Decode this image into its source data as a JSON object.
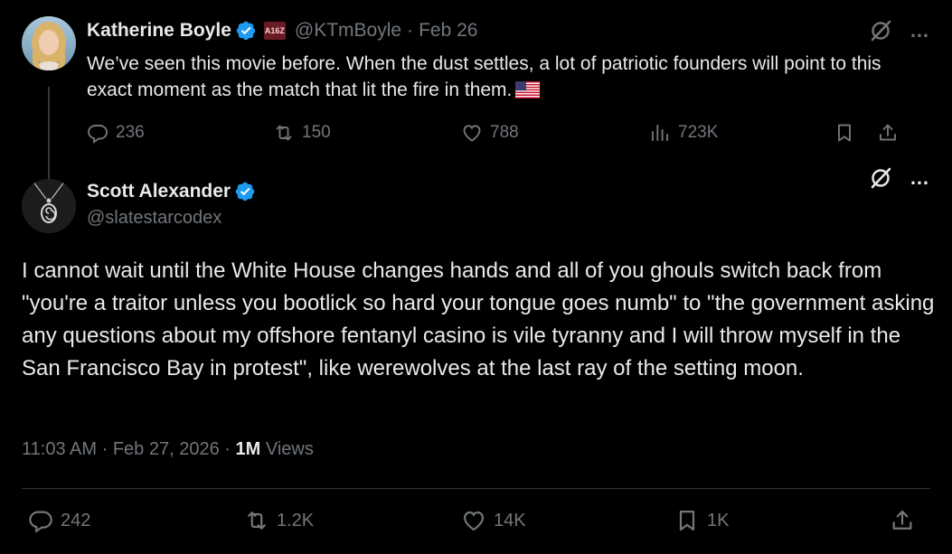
{
  "parent_tweet": {
    "author_name": "Katherine Boyle",
    "affiliate_badge": "A16Z",
    "handle": "@KTmBoyle",
    "separator": "·",
    "date": "Feb 26",
    "text": "We’ve seen this movie before. When the dust settles, a lot of patriotic founders will point to this exact moment as the match that lit the fire in them.",
    "actions": {
      "replies": "236",
      "reposts": "150",
      "likes": "788",
      "views": "723K"
    }
  },
  "main_tweet": {
    "author_name": "Scott Alexander",
    "handle": "@slatestarcodex",
    "text": "I cannot wait until the White House changes hands and all of you ghouls switch back from \"you're a traitor unless you bootlick so hard your tongue goes numb\" to \"the government asking any questions about my offshore fentanyl casino is vile tyranny and I will throw myself in the San Francisco Bay in protest\", like werewolves at the last ray of the setting moon.",
    "time": "11:03 AM",
    "separator": "·",
    "date": "Feb 27, 2026",
    "views_count": "1M",
    "views_label": "Views",
    "actions": {
      "replies": "242",
      "reposts": "1.2K",
      "likes": "14K",
      "bookmarks": "1K"
    }
  },
  "icons": {
    "more": "…",
    "verified_color": "#1d9bf0",
    "muted_color": "#71767b"
  }
}
